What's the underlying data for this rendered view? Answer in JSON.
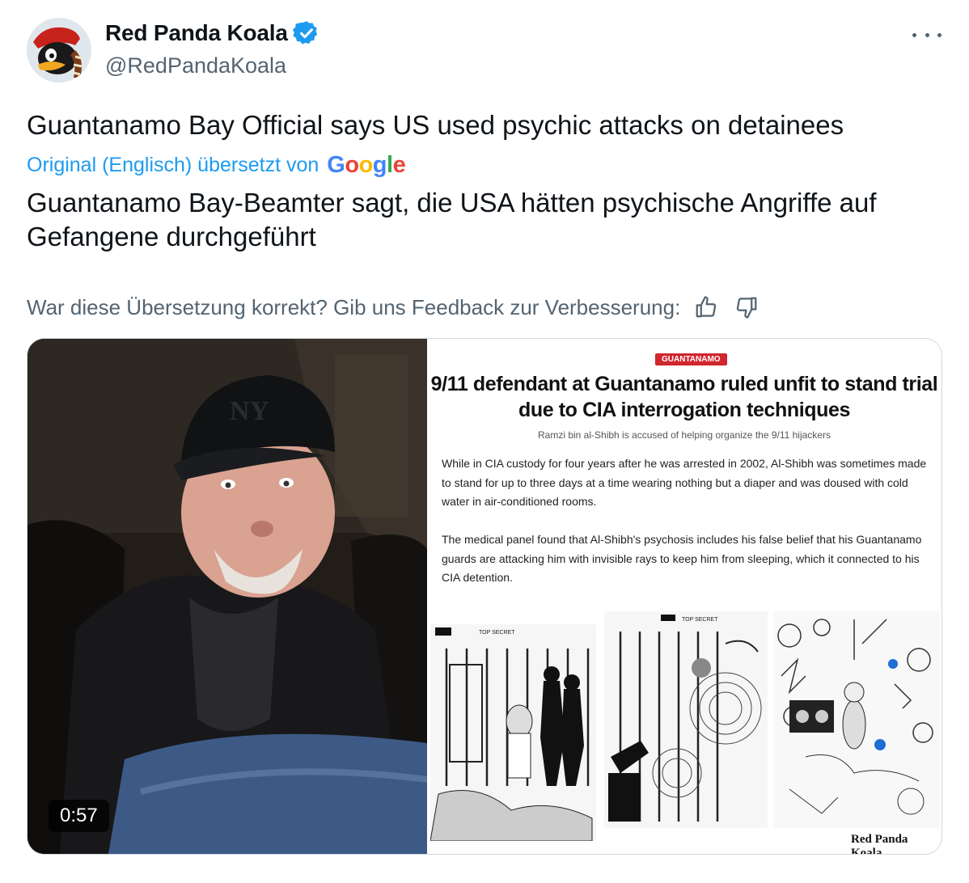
{
  "author": {
    "display_name": "Red Panda Koala",
    "handle": "@RedPandaKoala",
    "verified": true,
    "avatar_icon": "cartoon-duck-avatar"
  },
  "tweet": {
    "original_text": "Guantanamo Bay Official says US used psychic attacks on detainees",
    "translated_by_label": "Original (Englisch) übersetzt von",
    "translator_logo": "Google",
    "translated_text": "Guantanamo Bay-Beamter sagt, die USA hätten psychische Angriffe auf Gefangene durchgeführt",
    "feedback_prompt": "War diese Übersetzung korrekt? Gib uns Feedback zur Verbesserung:"
  },
  "media": {
    "video_duration": "0:57",
    "article": {
      "tag": "GUANTANAMO",
      "headline": "9/11 defendant at Guantanamo ruled unfit to stand trial due to CIA interrogation techniques",
      "subhead": "Ramzi bin al-Shibh is accused of helping organize the 9/11 hijackers",
      "paragraph_1": "While in CIA custody for four years after he was arrested in 2002, Al-Shibh was sometimes made to stand for up to three days at a time wearing nothing but a diaper and was doused with cold water in air-conditioned rooms.",
      "paragraph_2": "The medical panel found that Al-Shibh's psychosis includes his false belief that his Guantanamo guards are attacking him with invisible rays to keep him from sleeping, which it connected to his CIA detention.",
      "drawing_header_1": "TOP SECRET",
      "drawing_header_2": "TOP SECRET",
      "watermark": "Red Panda Koala"
    }
  },
  "colors": {
    "accent": "#1d9bf0",
    "secondary_text": "#536471",
    "tag_red": "#d0262e"
  }
}
